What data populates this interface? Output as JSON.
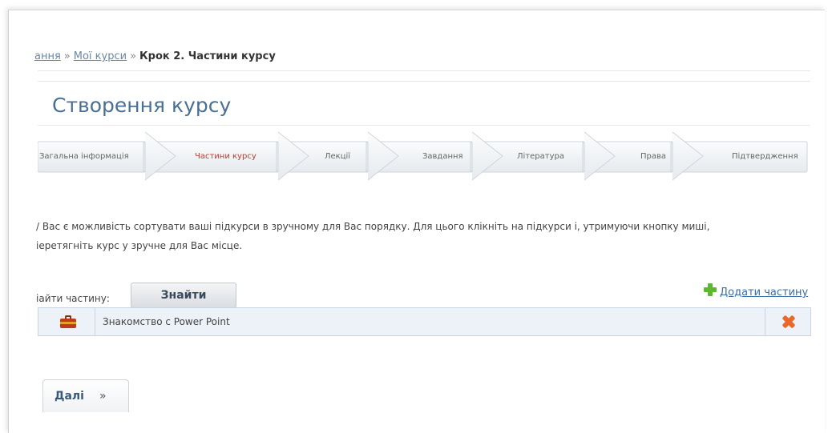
{
  "breadcrumb": {
    "item1": "ання",
    "sep": "»",
    "item2": "Мої курси",
    "current": "Крок 2. Частини курсу"
  },
  "page_title": "Створення курсу",
  "steps": [
    {
      "label": "Загальна інформація",
      "active": false
    },
    {
      "label": "Частини курсу",
      "active": true
    },
    {
      "label": "Лекції",
      "active": false
    },
    {
      "label": "Завдання",
      "active": false
    },
    {
      "label": "Література",
      "active": false
    },
    {
      "label": "Права",
      "active": false
    },
    {
      "label": "Підтвердження",
      "active": false
    }
  ],
  "info": {
    "line1": "/ Вас є можливість сортувати ваші підкурси в зручному для Вас порядку. Для цього клікніть на підкурси і, утримуючи кнопку миші,",
    "line2": "іеретягніть курс у зручне для Вас місце."
  },
  "search": {
    "label": "іайти частину:",
    "button": "Знайти"
  },
  "add_link": "Додати частину",
  "parts": [
    {
      "name": "Знакомство с Power Point",
      "icon": "briefcase-icon",
      "delete_icon": "delete-icon"
    }
  ],
  "next_button": {
    "label": "Далі",
    "arrow": "»"
  },
  "colors": {
    "title": "#4a6f95",
    "active_step": "#c0392b",
    "link": "#3a6ea5",
    "row_bg": "#edf2f8",
    "add_icon": "#5cb82e",
    "delete_icon": "#e8692a"
  }
}
